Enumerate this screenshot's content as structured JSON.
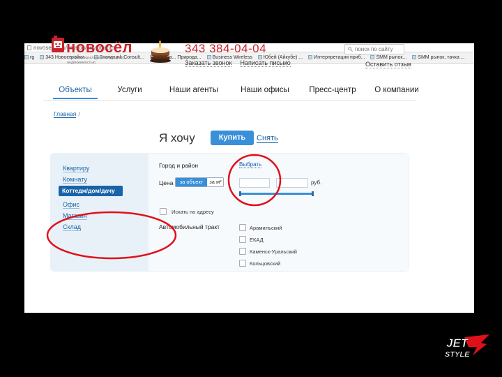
{
  "browser": {
    "url": "novosel99.ru/catalog/buy/pt-dom/",
    "bookmarks": [
      "rg",
      "343 Новостройки...",
      "Snowpunk Consult...",
      "Страна... Природа...",
      "Business Wireless",
      "Юбей (Айкубе) ...",
      "Интерпретация приб...",
      "SMM рынок...",
      "SMM рынок, тачка ..."
    ]
  },
  "header": {
    "logo_text": "новосёл",
    "logo_sub": "Профессиональные операции с недвижимостью",
    "phone": "343 384-04-04",
    "link_call": "Заказать звонок",
    "link_letter": "Написать письмо",
    "search_placeholder": "поиск по сайту",
    "review_link": "Оставить отзыв"
  },
  "nav": {
    "items": [
      "Объекты",
      "Услуги",
      "Наши агенты",
      "Наши офисы",
      "Пресс-центр",
      "О компании"
    ]
  },
  "breadcrumb": {
    "home": "Главная",
    "sep": "/"
  },
  "want": {
    "label": "Я хочу",
    "buy": "Купить",
    "rent": "Снять"
  },
  "categories": [
    "Квартиру",
    "Комнату",
    "Коттедж/дом/дачу",
    "Офис",
    "Магазин",
    "Склад"
  ],
  "filters": {
    "city_label": "Город и район",
    "city_value": "Выбрать",
    "price_label": "Цена",
    "price_per_object": "за объект",
    "price_per_sqm": "за м²",
    "currency": "руб.",
    "search_by_address": "Искать по адресу",
    "highway_label": "Автомобильный тракт",
    "highways": [
      "Арамильский",
      "ЕКАД",
      "Каменск-Уральский",
      "Кольцовский"
    ]
  },
  "colors": {
    "brand_red": "#c8232b",
    "accent_blue": "#3a8fd9",
    "link_blue": "#1a63a8",
    "annotation_red": "#e0101a"
  },
  "watermark": "JET STYLE"
}
